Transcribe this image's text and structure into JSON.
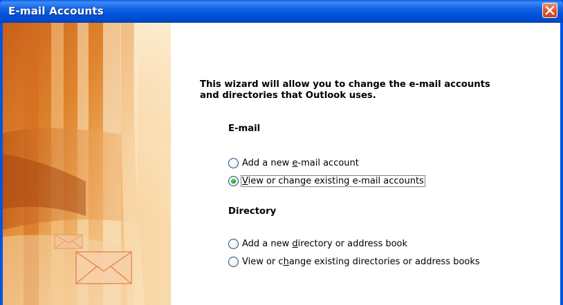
{
  "window": {
    "title": "E-mail Accounts",
    "close_icon": "close-icon",
    "colors": {
      "titlebar": "#0054e3",
      "close_button": "#e25a32",
      "banner_accent": "#d9822b"
    }
  },
  "intro_text": "This wizard will allow you to change the e-mail accounts and directories that Outlook uses.",
  "email_group": {
    "label": "E-mail",
    "options": [
      {
        "pre": "Add a new ",
        "key": "e",
        "post": "-mail account",
        "checked": false
      },
      {
        "pre": "",
        "key": "V",
        "post": "iew or change existing e-mail accounts",
        "checked": true
      }
    ]
  },
  "directory_group": {
    "label": "Directory",
    "options": [
      {
        "pre": "Add a new ",
        "key": "d",
        "post": "irectory or address book",
        "checked": false
      },
      {
        "pre": "View or c",
        "key": "h",
        "post": "ange existing directories or address books",
        "checked": false
      }
    ]
  }
}
